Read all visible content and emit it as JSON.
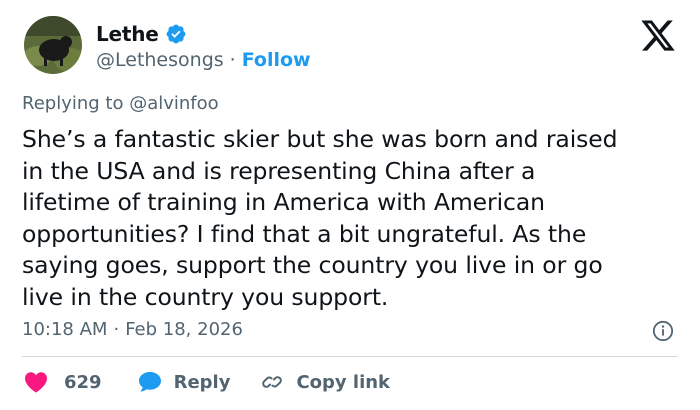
{
  "author": {
    "display_name": "Lethe",
    "handle": "@Lethesongs",
    "separator": "·",
    "follow_label": "Follow"
  },
  "icons": {
    "verified": "verified-badge-icon",
    "logo": "x-logo-icon",
    "info": "info-icon",
    "like": "heart-icon",
    "reply": "speech-bubble-icon",
    "copy": "link-icon"
  },
  "colors": {
    "accent": "#1d9bf0",
    "like": "#f91880",
    "text": "#0f1419",
    "secondary": "#536471",
    "divider": "#cfd9de"
  },
  "reply_context": {
    "prefix": "Replying to",
    "mention": "@alvinfoo"
  },
  "tweet": {
    "text": "She’s a fantastic skier but she was born and raised\nin the USA and is representing China after a\nlifetime of training in America with American\nopportunities? I find that a bit ungrateful. As the\nsaying goes, support the country you live in or go\nlive in the country you support.",
    "time": "10:18 AM",
    "separator": "·",
    "date": "Feb 18, 2026"
  },
  "actions": {
    "like_count": "629",
    "reply_label": "Reply",
    "copy_link_label": "Copy link"
  }
}
